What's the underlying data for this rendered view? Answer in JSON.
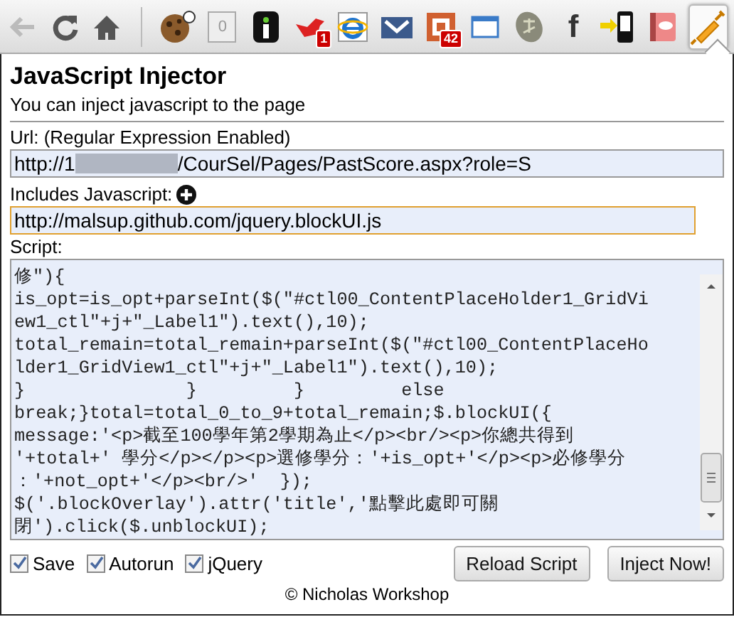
{
  "toolbar": {
    "nav": [
      {
        "kind": "back",
        "disabled": true
      },
      {
        "kind": "reload",
        "disabled": false
      },
      {
        "kind": "home",
        "disabled": false
      }
    ],
    "extensions": [
      {
        "kind": "cookie",
        "selected": false
      },
      {
        "kind": "counter",
        "text": "0",
        "selected": false
      },
      {
        "kind": "info",
        "selected": false
      },
      {
        "kind": "bird",
        "badge": "1",
        "selected": false
      },
      {
        "kind": "ie",
        "selected": false
      },
      {
        "kind": "mail",
        "selected": false
      },
      {
        "kind": "slides",
        "badge": "42",
        "selected": false
      },
      {
        "kind": "window",
        "selected": false
      },
      {
        "kind": "translate",
        "selected": false
      },
      {
        "kind": "facebook",
        "text": "f",
        "selected": false
      },
      {
        "kind": "phone",
        "selected": false
      },
      {
        "kind": "book",
        "selected": false
      },
      {
        "kind": "syringe",
        "selected": true
      }
    ]
  },
  "popup": {
    "title": "JavaScript Injector",
    "subtitle": "You can inject javascript to the page",
    "url": {
      "label": "Url: (Regular Expression Enabled)",
      "value_start": "http://1",
      "value_end": "/CourSel/Pages/PastScore.aspx?role=S"
    },
    "includes": {
      "label": "Includes Javascript:",
      "value": "http://malsup.github.com/jquery.blockUI.js"
    },
    "script": {
      "label": "Script:",
      "lines": [
        "修\"){",
        "is_opt=is_opt+parseInt($(\"#ctl00_ContentPlaceHolder1_GridVi",
        "ew1_ctl\"+j+\"_Label1\").text(),10);",
        "total_remain=total_remain+parseInt($(\"#ctl00_ContentPlaceHo",
        "lder1_GridView1_ctl\"+j+\"_Label1\").text(),10);",
        "}               }         }         else",
        "break;}total=total_0_to_9+total_remain;$.blockUI({",
        "message:'<p>截至100學年第2學期為止</p><br/><p>你總共得到",
        "'+total+' 學分</p></p><p>選修學分：'+is_opt+'</p><p>必修學分",
        "：'+not_opt+'</p><br/>'  });",
        "$('.blockOverlay').attr('title','點擊此處即可關",
        "閉').click($.unblockUI);"
      ]
    },
    "options": [
      {
        "label": "Save",
        "checked": true
      },
      {
        "label": "Autorun",
        "checked": true
      },
      {
        "label": "jQuery",
        "checked": true
      }
    ],
    "buttons": [
      "Reload Script",
      "Inject Now!"
    ],
    "footer": "© Nicholas Workshop"
  }
}
